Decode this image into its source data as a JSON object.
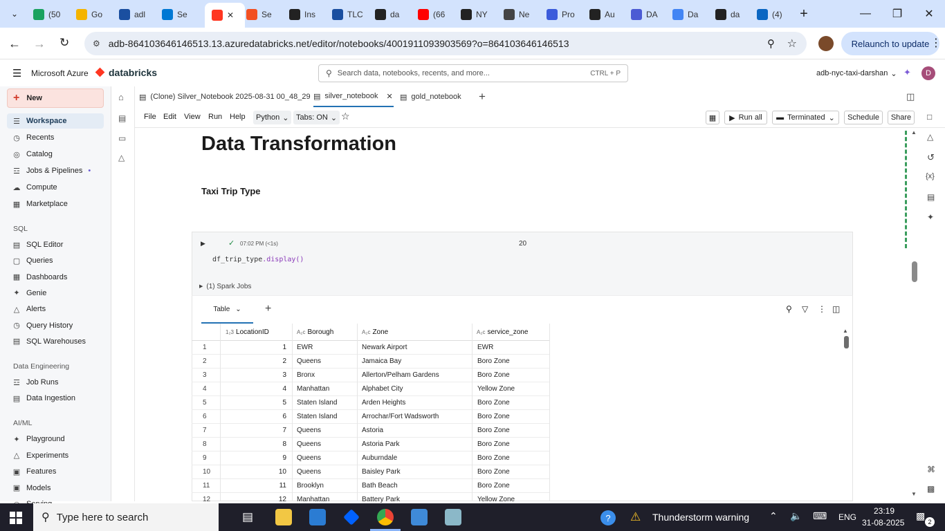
{
  "browser": {
    "tabs": [
      {
        "label": "(50",
        "color": "#1aa260"
      },
      {
        "label": "Go",
        "color": "#f4b400"
      },
      {
        "label": "adl",
        "color": "#1a4fa0"
      },
      {
        "label": "Se",
        "color": "#0078d4"
      },
      {
        "label": "",
        "color": "#ff3621"
      },
      {
        "label": "Se",
        "color": "#f25022"
      },
      {
        "label": "Ins",
        "color": "#222222"
      },
      {
        "label": "TLC",
        "color": "#1a4fa0"
      },
      {
        "label": "da",
        "color": "#222222"
      },
      {
        "label": "(66",
        "color": "#ff0000"
      },
      {
        "label": "NY",
        "color": "#222222"
      },
      {
        "label": "Ne",
        "color": "#444444"
      },
      {
        "label": "Pro",
        "color": "#3b5bdb"
      },
      {
        "label": "Au",
        "color": "#222222"
      },
      {
        "label": "DA",
        "color": "#4c5bd4"
      },
      {
        "label": "Da",
        "color": "#4285f4"
      },
      {
        "label": "da",
        "color": "#222222"
      },
      {
        "label": "(4)",
        "color": "#0a66c2"
      }
    ],
    "url": "adb-864103646146513.13.azuredatabricks.net/editor/notebooks/4001911093903569?o=864103646146513",
    "relaunch_label": "Relaunch to update"
  },
  "header": {
    "brand_microsoft": "Microsoft Azure",
    "brand_databricks": "databricks",
    "search_placeholder": "Search data, notebooks, recents, and more...",
    "search_shortcut": "CTRL + P",
    "workspace_name": "adb-nyc-taxi-darshan",
    "avatar_letter": "D"
  },
  "sidebar": {
    "new_label": "New",
    "items_top": [
      "Workspace",
      "Recents",
      "Catalog",
      "Jobs & Pipelines",
      "Compute",
      "Marketplace"
    ],
    "sql_head": "SQL",
    "items_sql": [
      "SQL Editor",
      "Queries",
      "Dashboards",
      "Genie",
      "Alerts",
      "Query History",
      "SQL Warehouses"
    ],
    "de_head": "Data Engineering",
    "items_de": [
      "Job Runs",
      "Data Ingestion"
    ],
    "ml_head": "AI/ML",
    "items_ml": [
      "Playground",
      "Experiments",
      "Features",
      "Models",
      "Serving"
    ]
  },
  "notebook": {
    "tabs": [
      "(Clone) Silver_Notebook 2025-08-31 00_48_29",
      "silver_notebook",
      "gold_notebook"
    ],
    "menu": [
      "File",
      "Edit",
      "View",
      "Run",
      "Help"
    ],
    "language": "Python",
    "tabs_toggle": "Tabs: ON",
    "run_all": "Run all",
    "cluster_state": "Terminated",
    "schedule": "Schedule",
    "share": "Share",
    "heading": "Data Transformation",
    "subheading": "Taxi Trip Type",
    "cell": {
      "exec_time": "07:02 PM (<1s)",
      "cell_number": "20",
      "code_var": "df_trip_type",
      "code_call": ".display()",
      "spark_jobs": "(1) Spark Jobs",
      "result_tab": "Table"
    }
  },
  "table": {
    "columns": [
      "LocationID",
      "Borough",
      "Zone",
      "service_zone"
    ],
    "rows": [
      [
        "1",
        "1",
        "EWR",
        "Newark Airport",
        "EWR"
      ],
      [
        "2",
        "2",
        "Queens",
        "Jamaica Bay",
        "Boro Zone"
      ],
      [
        "3",
        "3",
        "Bronx",
        "Allerton/Pelham Gardens",
        "Boro Zone"
      ],
      [
        "4",
        "4",
        "Manhattan",
        "Alphabet City",
        "Yellow Zone"
      ],
      [
        "5",
        "5",
        "Staten Island",
        "Arden Heights",
        "Boro Zone"
      ],
      [
        "6",
        "6",
        "Staten Island",
        "Arrochar/Fort Wadsworth",
        "Boro Zone"
      ],
      [
        "7",
        "7",
        "Queens",
        "Astoria",
        "Boro Zone"
      ],
      [
        "8",
        "8",
        "Queens",
        "Astoria Park",
        "Boro Zone"
      ],
      [
        "9",
        "9",
        "Queens",
        "Auburndale",
        "Boro Zone"
      ],
      [
        "10",
        "10",
        "Queens",
        "Baisley Park",
        "Boro Zone"
      ],
      [
        "11",
        "11",
        "Brooklyn",
        "Bath Beach",
        "Boro Zone"
      ],
      [
        "12",
        "12",
        "Manhattan",
        "Battery Park",
        "Yellow Zone"
      ]
    ]
  },
  "taskbar": {
    "search_placeholder": "Type here to search",
    "weather": "Thunderstorm warning",
    "lang": "ENG",
    "time": "23:19",
    "date": "31-08-2025",
    "notif_count": "2"
  }
}
